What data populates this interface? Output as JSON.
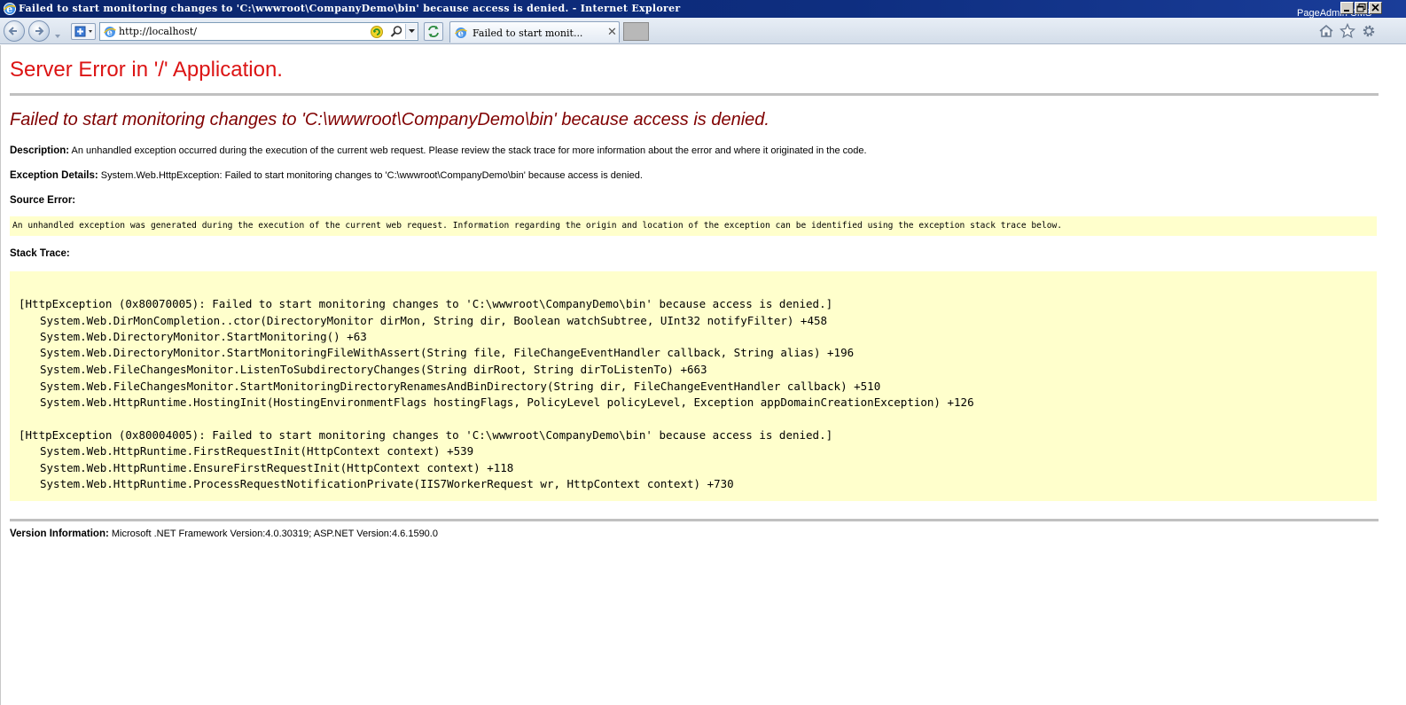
{
  "window": {
    "title": "Failed to start monitoring changes to 'C:\\wwwroot\\CompanyDemo\\bin' because access is denied. - Internet Explorer",
    "overlay_text": "PageAdmin CMS"
  },
  "toolbar": {
    "address_value": "http://localhost/",
    "tab_label": "Failed to start monit...",
    "tab_close": "✕"
  },
  "page": {
    "title": "Server Error in '/' Application.",
    "error_heading": "Failed to start monitoring changes to 'C:\\wwwroot\\CompanyDemo\\bin' because access is denied.",
    "description_label": "Description:",
    "description_text": "An unhandled exception occurred during the execution of the current web request. Please review the stack trace for more information about the error and where it originated in the code.",
    "exception_label": "Exception Details:",
    "exception_text": "System.Web.HttpException: Failed to start monitoring changes to 'C:\\wwwroot\\CompanyDemo\\bin' because access is denied.",
    "source_error_label": "Source Error:",
    "source_error_text": "An unhandled exception was generated during the execution of the current web request. Information regarding the origin and location of the exception can be identified using the exception stack trace below.",
    "stack_trace_label": "Stack Trace:",
    "stack_trace": [
      "[HttpException (0x80070005): Failed to start monitoring changes to 'C:\\wwwroot\\CompanyDemo\\bin' because access is denied.]",
      "System.Web.DirMonCompletion..ctor(DirectoryMonitor dirMon, String dir, Boolean watchSubtree, UInt32 notifyFilter) +458",
      "System.Web.DirectoryMonitor.StartMonitoring() +63",
      "System.Web.DirectoryMonitor.StartMonitoringFileWithAssert(String file, FileChangeEventHandler callback, String alias) +196",
      "System.Web.FileChangesMonitor.ListenToSubdirectoryChanges(String dirRoot, String dirToListenTo) +663",
      "System.Web.FileChangesMonitor.StartMonitoringDirectoryRenamesAndBinDirectory(String dir, FileChangeEventHandler callback) +510",
      "System.Web.HttpRuntime.HostingInit(HostingEnvironmentFlags hostingFlags, PolicyLevel policyLevel, Exception appDomainCreationException) +126",
      "[HttpException (0x80004005): Failed to start monitoring changes to 'C:\\wwwroot\\CompanyDemo\\bin' because access is denied.]",
      "System.Web.HttpRuntime.FirstRequestInit(HttpContext context) +539",
      "System.Web.HttpRuntime.EnsureFirstRequestInit(HttpContext context) +118",
      "System.Web.HttpRuntime.ProcessRequestNotificationPrivate(IIS7WorkerRequest wr, HttpContext context) +730"
    ],
    "version_label": "Version Information:",
    "version_text": "Microsoft .NET Framework Version:4.0.30319; ASP.NET Version:4.6.1590.0"
  },
  "colors": {
    "title_red": "#dc1414",
    "heading_maroon": "#800000",
    "code_bg": "#ffffcc"
  },
  "icons": [
    "ie-logo-icon",
    "back-icon",
    "forward-icon",
    "dropdown-icon",
    "new-tab-icon",
    "compat-view-icon",
    "search-icon",
    "refresh-icon",
    "tab-ie-icon",
    "close-icon",
    "home-icon",
    "favorites-star-icon",
    "settings-gear-icon",
    "minimize-icon",
    "maximize-icon"
  ]
}
